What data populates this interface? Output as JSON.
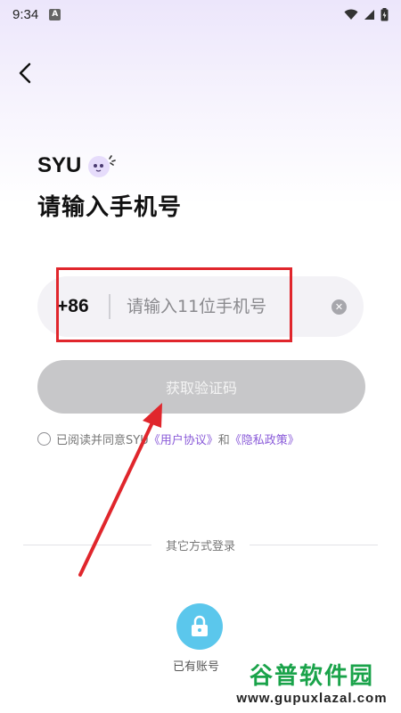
{
  "status_bar": {
    "time": "9:34",
    "notification_badge": "A",
    "icons": [
      "wifi-icon",
      "signal-icon",
      "battery-icon"
    ]
  },
  "header": {
    "back_icon": "chevron-left-icon"
  },
  "brand": {
    "name": "SYU"
  },
  "page": {
    "title": "请输入手机号"
  },
  "phone_field": {
    "country_code": "+86",
    "value": "",
    "placeholder": "请输入11位手机号"
  },
  "get_code_button": {
    "label": "获取验证码"
  },
  "agreement": {
    "prefix": "已阅读并同意SYU",
    "user_agreement": "《用户协议》",
    "conjunction": "和",
    "privacy_policy": "《隐私政策》"
  },
  "alt_login": {
    "divider_label": "其它方式登录",
    "account_label": "已有账号"
  },
  "watermark": {
    "title": "谷普软件园",
    "url": "www.gupuxlazal.com"
  },
  "colors": {
    "accent_link": "#8a5bd9",
    "button_disabled": "#c7c7c9",
    "lock_button": "#5bc7ec",
    "annotation_red": "#e0262c",
    "watermark_green": "#1aa34a"
  }
}
